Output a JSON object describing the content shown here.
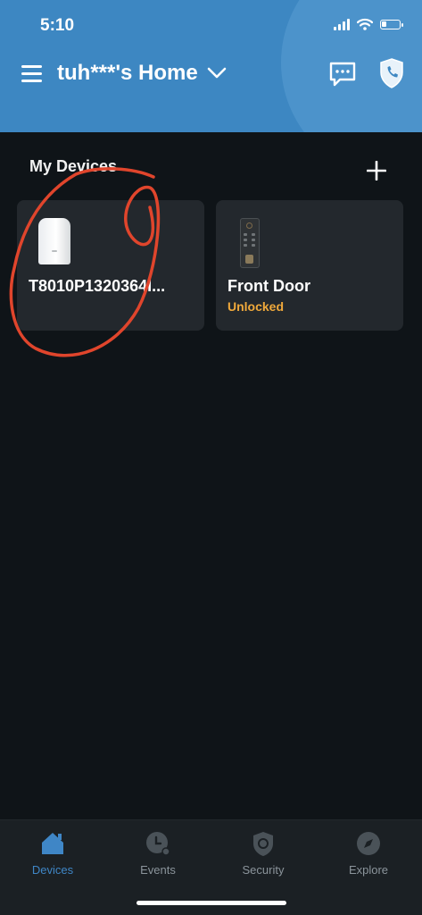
{
  "status_bar": {
    "time": "5:10",
    "icons": [
      "cellular-signal-icon",
      "wifi-icon",
      "battery-icon"
    ],
    "battery_level": 0.3
  },
  "header": {
    "title": "tuh***'s Home",
    "icons": [
      "menu-icon",
      "chevron-down-icon",
      "message-icon",
      "shield-phone-icon"
    ]
  },
  "section": {
    "title": "My Devices",
    "add_icon": "plus-icon"
  },
  "devices": [
    {
      "name": "T8010P1320364I...",
      "icon": "homebase-device-icon"
    },
    {
      "name": "Front Door",
      "status": "Unlocked",
      "icon": "smart-lock-icon"
    }
  ],
  "bottom_nav": {
    "items": [
      {
        "label": "Devices",
        "icon": "house-icon",
        "active": true
      },
      {
        "label": "Events",
        "icon": "clock-icon",
        "active": false
      },
      {
        "label": "Security",
        "icon": "shield-icon",
        "active": false
      },
      {
        "label": "Explore",
        "icon": "compass-icon",
        "active": false
      }
    ]
  },
  "colors": {
    "header_bg": "#3d87c2",
    "background": "#0f1418",
    "card_bg": "#23282d",
    "status_unlocked": "#f0a93b",
    "nav_active": "#3f86c6",
    "nav_inactive": "#8b949b",
    "annotation": "#e0452c"
  }
}
